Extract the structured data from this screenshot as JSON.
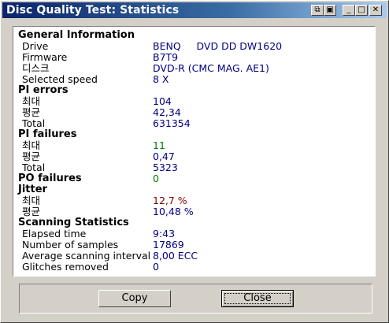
{
  "window": {
    "title": "Disc Quality Test: Statistics",
    "buttons": {
      "save_icon": "floppy-icon",
      "minimize": "_",
      "maximize": "□",
      "close": "✕"
    }
  },
  "general": {
    "heading": "General Information",
    "drive_label": "Drive",
    "drive_value": "BENQ     DVD DD DW1620",
    "firmware_label": "Firmware",
    "firmware_value": "B7T9",
    "disc_label": "디스크",
    "disc_value": "DVD-R (CMC MAG. AE1)",
    "speed_label": "Selected speed",
    "speed_value": "8 X"
  },
  "pi_errors": {
    "heading": "PI errors",
    "max_label": "최대",
    "max_value": "104",
    "avg_label": "평균",
    "avg_value": "42,34",
    "total_label": "Total",
    "total_value": "631354"
  },
  "pi_failures": {
    "heading": "PI failures",
    "max_label": "최대",
    "max_value": "11",
    "avg_label": "평균",
    "avg_value": "0,47",
    "total_label": "Total",
    "total_value": "5323"
  },
  "po_failures": {
    "heading": "PO failures",
    "value": "0"
  },
  "jitter": {
    "heading": "Jitter",
    "max_label": "최대",
    "max_value": "12,7 %",
    "avg_label": "평균",
    "avg_value": "10,48 %"
  },
  "scanning": {
    "heading": "Scanning Statistics",
    "elapsed_label": "Elapsed time",
    "elapsed_value": "9:43",
    "samples_label": "Number of samples",
    "samples_value": "17869",
    "interval_label": "Average scanning interval",
    "interval_value": "8,00 ECC",
    "glitches_label": "Glitches removed",
    "glitches_value": "0"
  },
  "actions": {
    "copy": "Copy",
    "close": "Close"
  },
  "colors": {
    "value_blue": "#000080",
    "good_green": "#008000",
    "warn_red": "#800000",
    "title_bar": "#0a246a"
  }
}
